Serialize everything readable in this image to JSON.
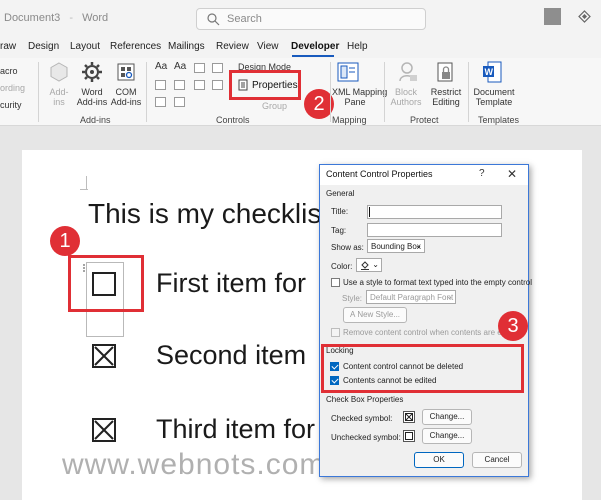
{
  "titlebar": {
    "doc_name": "Document3",
    "app_name": "Word",
    "search_placeholder": "Search"
  },
  "tabs": [
    "raw",
    "Design",
    "Layout",
    "References",
    "Mailings",
    "Review",
    "View",
    "Developer",
    "Help"
  ],
  "active_tab": "Developer",
  "ribbon": {
    "left_partial": [
      "acro",
      "ording",
      "curity"
    ],
    "addins": {
      "addins_label": "Add-\nins",
      "word_addins": "Word\nAdd-ins",
      "com_addins": "COM\nAdd-ins",
      "group": "Add-ins"
    },
    "controls": {
      "aa1": "Aa",
      "aa2": "Aa",
      "design_mode": "Design Mode",
      "properties": "Properties",
      "group_label": "Group",
      "group": "Controls"
    },
    "mapping": {
      "xml_mapping": "XML Mapping\nPane",
      "group": "Mapping"
    },
    "protect": {
      "block_authors": "Block\nAuthors",
      "restrict_editing": "Restrict\nEditing",
      "group": "Protect"
    },
    "templates": {
      "document_template": "Document\nTemplate",
      "group": "Templates"
    }
  },
  "callouts": [
    "1",
    "2",
    "3"
  ],
  "document": {
    "heading": "This is my checklist",
    "items": [
      "First item for",
      "Second item",
      "Third item for"
    ],
    "watermark": "www.webnots.com"
  },
  "dialog": {
    "title": "Content Control Properties",
    "help": "?",
    "close": "✕",
    "general": "General",
    "title_label": "Title:",
    "title_value": "",
    "tag_label": "Tag:",
    "tag_value": "",
    "show_as_label": "Show as:",
    "show_as_value": "Bounding Box",
    "color_label": "Color:",
    "use_style_label": "Use a style to format text typed into the empty control",
    "style_label": "Style:",
    "style_value": "Default Paragraph Font",
    "new_style": "New Style...",
    "remove_label": "Remove content control when contents are edited",
    "locking": "Locking",
    "lock_delete": "Content control cannot be deleted",
    "lock_edit": "Contents cannot be edited",
    "checkbox_props": "Check Box Properties",
    "checked_symbol": "Checked symbol:",
    "unchecked_symbol": "Unchecked symbol:",
    "change1": "Change...",
    "change2": "Change...",
    "ok": "OK",
    "cancel": "Cancel"
  },
  "colors": {
    "accent_red": "#e02f35",
    "word_blue": "#185abd",
    "checkbox_blue": "#0067c0"
  }
}
